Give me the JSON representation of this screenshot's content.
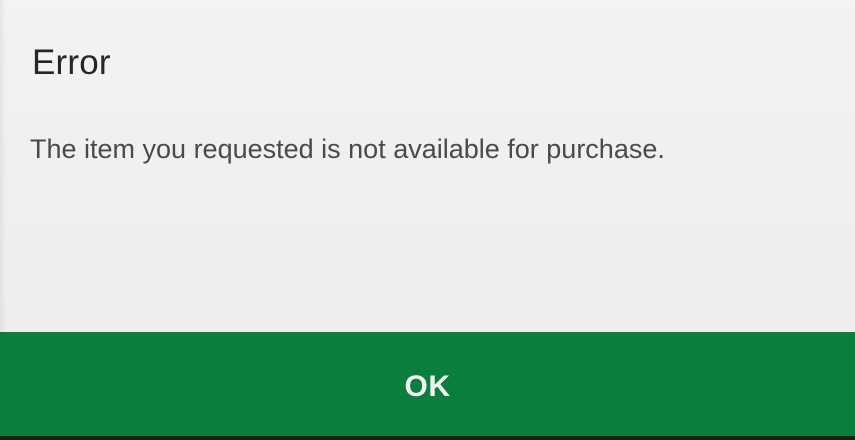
{
  "dialog": {
    "title": "Error",
    "message": "The item you requested is not available for purchase.",
    "ok_label": "OK"
  },
  "colors": {
    "background": "#efefed",
    "action_bar": "#0a7e3d",
    "title_text": "#262626",
    "message_text": "#4a4a4a",
    "button_text": "#f4f4f4"
  }
}
